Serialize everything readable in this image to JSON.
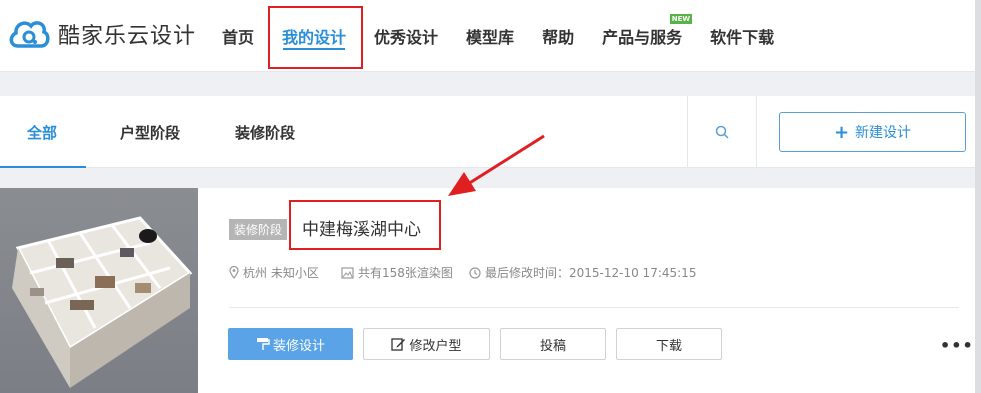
{
  "brand": {
    "name": "酷家乐云设计",
    "logo_icon": "cloud-logo-icon",
    "logo_color": "#2b8fd8"
  },
  "nav": {
    "items": [
      {
        "label": "首页",
        "active": false
      },
      {
        "label": "我的设计",
        "active": true
      },
      {
        "label": "优秀设计",
        "active": false
      },
      {
        "label": "模型库",
        "active": false
      },
      {
        "label": "帮助",
        "active": false
      },
      {
        "label": "产品与服务",
        "active": false,
        "badge": "NEW"
      },
      {
        "label": "软件下载",
        "active": false
      }
    ]
  },
  "tabs": {
    "items": [
      {
        "label": "全部",
        "active": true
      },
      {
        "label": "户型阶段",
        "active": false
      },
      {
        "label": "装修阶段",
        "active": false
      }
    ],
    "search_icon": "search-icon",
    "new_design_label": "新建设计",
    "new_design_icon": "plus-icon"
  },
  "design_card": {
    "stage_badge": "装修阶段",
    "title": "中建梅溪湖中心",
    "location": "杭州 未知小区",
    "render_count": "共有158张渲染图",
    "modified": "最后修改时间：2015-12-10 17:45:15",
    "actions": {
      "decorate": "装修设计",
      "edit_floorplan": "修改户型",
      "submit": "投稿",
      "download": "下载"
    },
    "more_icon": "more-dots-icon"
  },
  "colors": {
    "accent": "#2b8fd8",
    "primary_button": "#5aa3e6",
    "highlight": "#e02020",
    "new_badge": "#58b348"
  }
}
